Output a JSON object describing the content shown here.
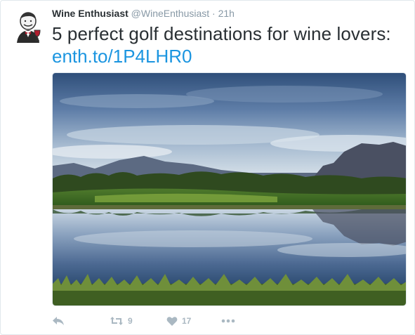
{
  "tweet": {
    "author_name": "Wine Enthusiast",
    "author_handle": "@WineEnthusiast",
    "separator": "·",
    "timestamp": "21h",
    "text": "5 perfect golf destinations for wine lovers:",
    "link_text": "enth.to/1P4LHR0",
    "avatar_icon": "sommelier-avatar-icon",
    "media_description_icon": "golf-course-photo"
  },
  "actions": {
    "reply_icon": "reply-icon",
    "retweet_icon": "retweet-icon",
    "retweet_count": "9",
    "like_icon": "heart-icon",
    "like_count": "17",
    "more_icon": "more-dots-icon"
  },
  "colors": {
    "link": "#1b95e0",
    "meta_gray": "#8899a6",
    "action_gray": "#aab8c2",
    "text": "#292f33"
  }
}
